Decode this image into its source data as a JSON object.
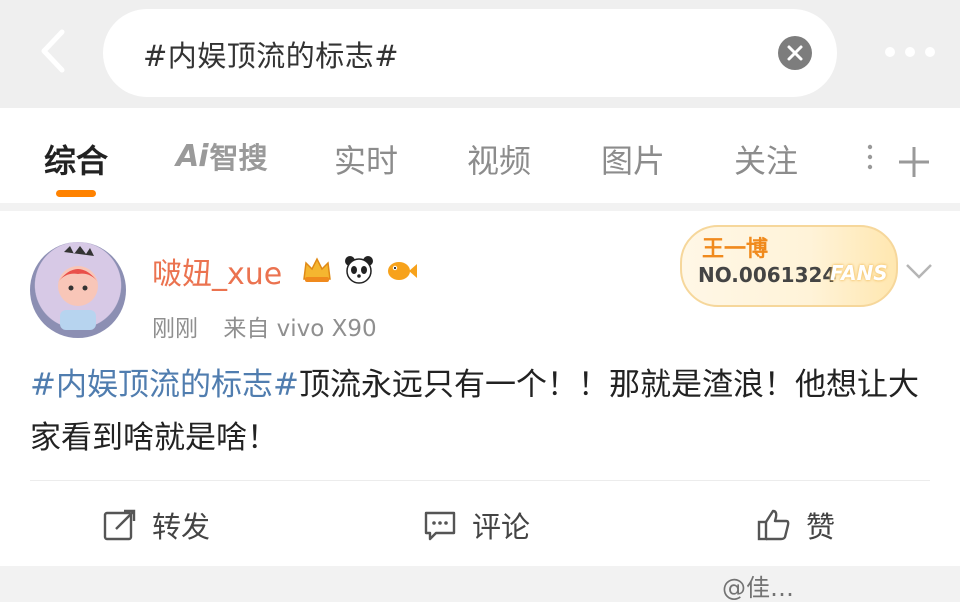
{
  "search": {
    "query": "#内娱顶流的标志#"
  },
  "tabs": [
    {
      "label": "综合",
      "active": true
    },
    {
      "label": "智搜",
      "logo": "Ai"
    },
    {
      "label": "实时"
    },
    {
      "label": "视频"
    },
    {
      "label": "图片"
    },
    {
      "label": "关注"
    }
  ],
  "post": {
    "username": "啵妞_xue",
    "badges": [
      "crown-badge",
      "panda-badge",
      "fish-badge"
    ],
    "time": "刚刚",
    "source": "来自 vivo X90",
    "fan_badge": {
      "name": "王一博",
      "number": "NO.0061324",
      "tag": "FANS"
    },
    "hashtag": "#内娱顶流的标志#",
    "text": "顶流永远只有一个！！那就是渣浪！他想让大家看到啥就是啥！",
    "actions": {
      "repost": "转发",
      "comment": "评论",
      "like": "赞"
    }
  },
  "watermark": "@佳…",
  "colors": {
    "accent": "#ff8200",
    "username": "#eb7350",
    "hashtag": "#507daf",
    "fan_name": "#f08a1d"
  }
}
